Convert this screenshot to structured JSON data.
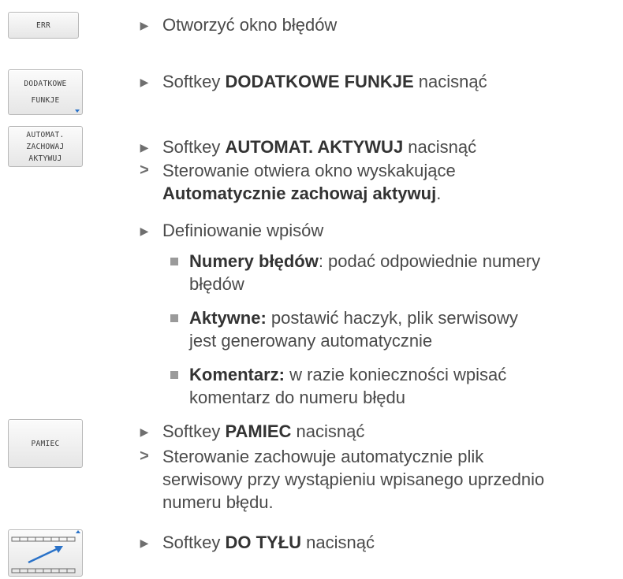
{
  "keys": {
    "err": [
      "ERR"
    ],
    "dodatkowe": [
      "DODATKOWE",
      "FUNKJE"
    ],
    "automat": [
      "AUTOMAT.",
      "ZACHOWAJ",
      "AKTYWUJ"
    ],
    "pamiec": [
      "PAMIEC"
    ],
    "back_icon": "arrow-up-right-icon"
  },
  "steps": {
    "s1": {
      "text": "Otworzyć okno błędów"
    },
    "s2": {
      "pre": "Softkey ",
      "bold": "DODATKOWE FUNKJE",
      "post": " nacisnąć"
    },
    "s3": {
      "pre": "Softkey ",
      "bold": "AUTOMAT. AKTYWUJ",
      "post": " nacisnąć"
    },
    "r3": {
      "line1": "Sterowanie otwiera okno wyskakujące",
      "bold": "Automatycznie zachowaj aktywuj",
      "post": "."
    },
    "s4": {
      "text": "Definiowanie wpisów"
    },
    "b1": {
      "bold": "Numery błędów",
      "line1": ": podać odpowiednie numery",
      "line2": "błędów"
    },
    "b2": {
      "bold": "Aktywne:",
      "line1": " postawić haczyk, plik serwisowy",
      "line2": "jest generowany automatycznie"
    },
    "b3": {
      "bold": "Komentarz:",
      "line1": " w razie konieczności wpisać",
      "line2": "komentarz do numeru błędu"
    },
    "s5": {
      "pre": "Softkey ",
      "bold": "PAMIEC",
      "post": " nacisnąć"
    },
    "r5": {
      "line1": "Sterowanie zachowuje automatycznie plik",
      "line2": "serwisowy przy wystąpieniu wpisanego uprzednio",
      "line3": "numeru błędu."
    },
    "s6": {
      "pre": "Softkey ",
      "bold": "DO TYŁU",
      "post": " nacisnąć"
    }
  },
  "markers": {
    "action": "▶",
    "result": ">"
  },
  "colors": {
    "text": "#4a4a4a",
    "marker": "#6f6f6f",
    "accent": "#2a72c8",
    "bullet": "#9a9a9a"
  }
}
